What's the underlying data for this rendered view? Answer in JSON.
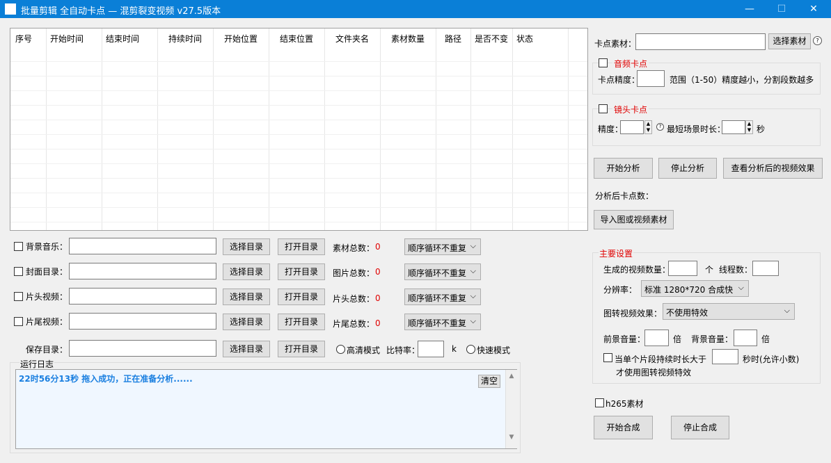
{
  "window": {
    "title": "批量剪辑   全自动卡点 — 混剪裂变视频    v27.5版本",
    "minimize": "—",
    "maximize": "☐",
    "close": "✕"
  },
  "table": {
    "columns": [
      "序号",
      "开始时间",
      "结束时间",
      "持续时间",
      "开始位置",
      "结束位置",
      "文件夹名",
      "素材数量",
      "路径",
      "是否不变",
      "状态"
    ]
  },
  "left_rows": [
    {
      "label": "背景音乐：",
      "select_dir": "选择目录",
      "open_dir": "打开目录",
      "count_label": "素材总数：",
      "count": "0",
      "order": "顺序循环不重复"
    },
    {
      "label": "封面目录：",
      "select_dir": "选择目录",
      "open_dir": "打开目录",
      "count_label": "图片总数：",
      "count": "0",
      "order": "顺序循环不重复"
    },
    {
      "label": "片头视频：",
      "select_dir": "选择目录",
      "open_dir": "打开目录",
      "count_label": "片头总数：",
      "count": "0",
      "order": "顺序循环不重复"
    },
    {
      "label": "片尾视频：",
      "select_dir": "选择目录",
      "open_dir": "打开目录",
      "count_label": "片尾总数：",
      "count": "0",
      "order": "顺序循环不重复"
    }
  ],
  "save_row": {
    "label": "保存目录：",
    "select_dir": "选择目录",
    "open_dir": "打开目录",
    "hd_mode": "高清模式",
    "bitrate_label": "比特率：",
    "bitrate_unit": "k",
    "fast_mode": "快速模式"
  },
  "log": {
    "title": "运行日志",
    "message": "22时56分13秒 拖入成功，正在准备分析......",
    "clear": "清空"
  },
  "right": {
    "material_label": "卡点素材：",
    "choose_material": "选择素材",
    "help": "?",
    "audio_group": {
      "title": "音频卡点",
      "precision_label": "卡点精度：",
      "range_hint": "范围（1-50）精度越小，分割段数越多"
    },
    "shot_group": {
      "title": "镜头卡点",
      "precision_label": "精度：",
      "help": "?",
      "min_scene_label": "最短场景时长：",
      "seconds": "秒"
    },
    "start_analysis": "开始分析",
    "stop_analysis": "停止分析",
    "view_result": "查看分析后的视频效果",
    "points_label": "分析后卡点数：",
    "import_material": "导入图或视频素材",
    "main_settings": {
      "title": "主要设置",
      "gen_count_label": "生成的视频数量：",
      "gen_count_unit": "个",
      "threads_label": "线程数：",
      "resolution_label": "分辨率：",
      "resolution_value": "标准 1280*720 合成快",
      "effect_label": "图转视频效果：",
      "effect_value": "不使用特效",
      "fg_volume_label": "前景音量：",
      "fg_volume_unit": "倍",
      "bg_volume_label": "背景音量：",
      "bg_volume_unit": "倍",
      "clip_check_label": "当单个片段持续时长大于",
      "clip_check_suffix": "秒时(允许小数)",
      "clip_check_line2": "才使用图转视频特效"
    },
    "h265_label": "h265素材",
    "start_compose": "开始合成",
    "stop_compose": "停止合成"
  }
}
